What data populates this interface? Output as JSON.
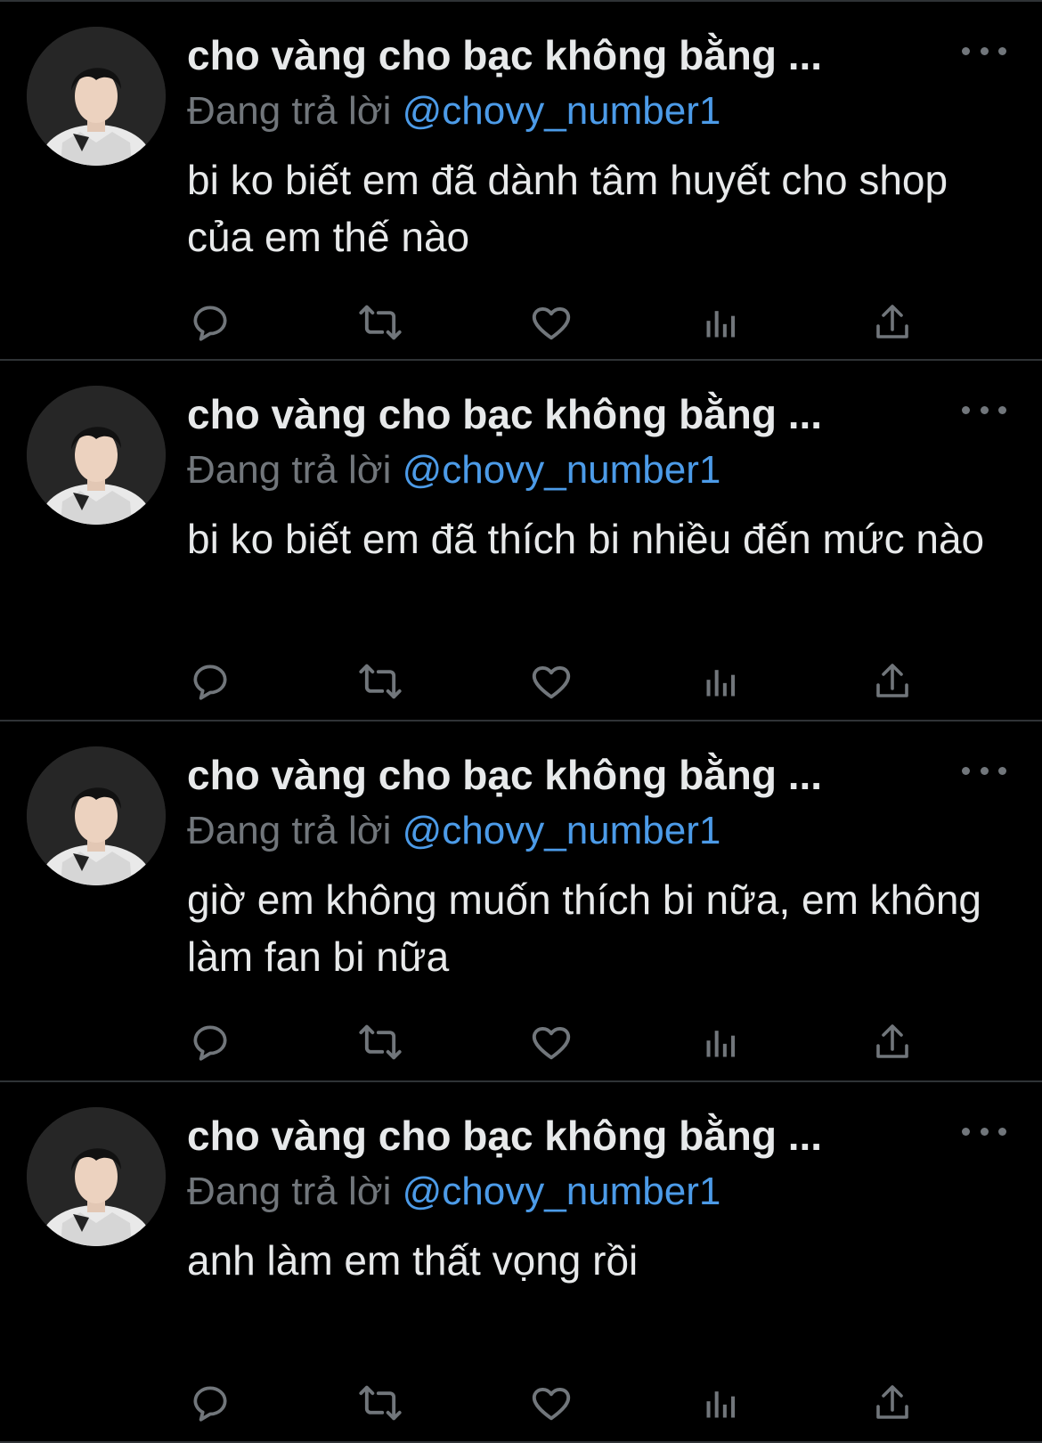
{
  "colors": {
    "background": "#000000",
    "text_primary": "#e7e9ea",
    "text_secondary": "#71767b",
    "link": "#4c9be8",
    "divider": "#2f3336"
  },
  "icons": {
    "more": "more-dots-icon",
    "reply": "reply-icon",
    "retweet": "retweet-icon",
    "like": "heart-icon",
    "views": "views-chart-icon",
    "share": "share-icon"
  },
  "tweets": [
    {
      "display_name": "cho vàng cho bạc không bằng ...",
      "reply_prefix": "Đang trả lời",
      "reply_handle": "@chovy_number1",
      "text": "bi ko biết em đã dành tâm huyết cho shop của em thế nào"
    },
    {
      "display_name": "cho vàng cho bạc không bằng ...",
      "reply_prefix": "Đang trả lời",
      "reply_handle": "@chovy_number1",
      "text": "bi ko biết em đã thích bi nhiều đến mức nào"
    },
    {
      "display_name": "cho vàng cho bạc không bằng ...",
      "reply_prefix": "Đang trả lời",
      "reply_handle": "@chovy_number1",
      "text": "giờ em không muốn thích bi nữa, em không làm fan bi nữa"
    },
    {
      "display_name": "cho vàng cho bạc không bằng ...",
      "reply_prefix": "Đang trả lời",
      "reply_handle": "@chovy_number1",
      "text": "anh làm em thất vọng rồi"
    }
  ]
}
